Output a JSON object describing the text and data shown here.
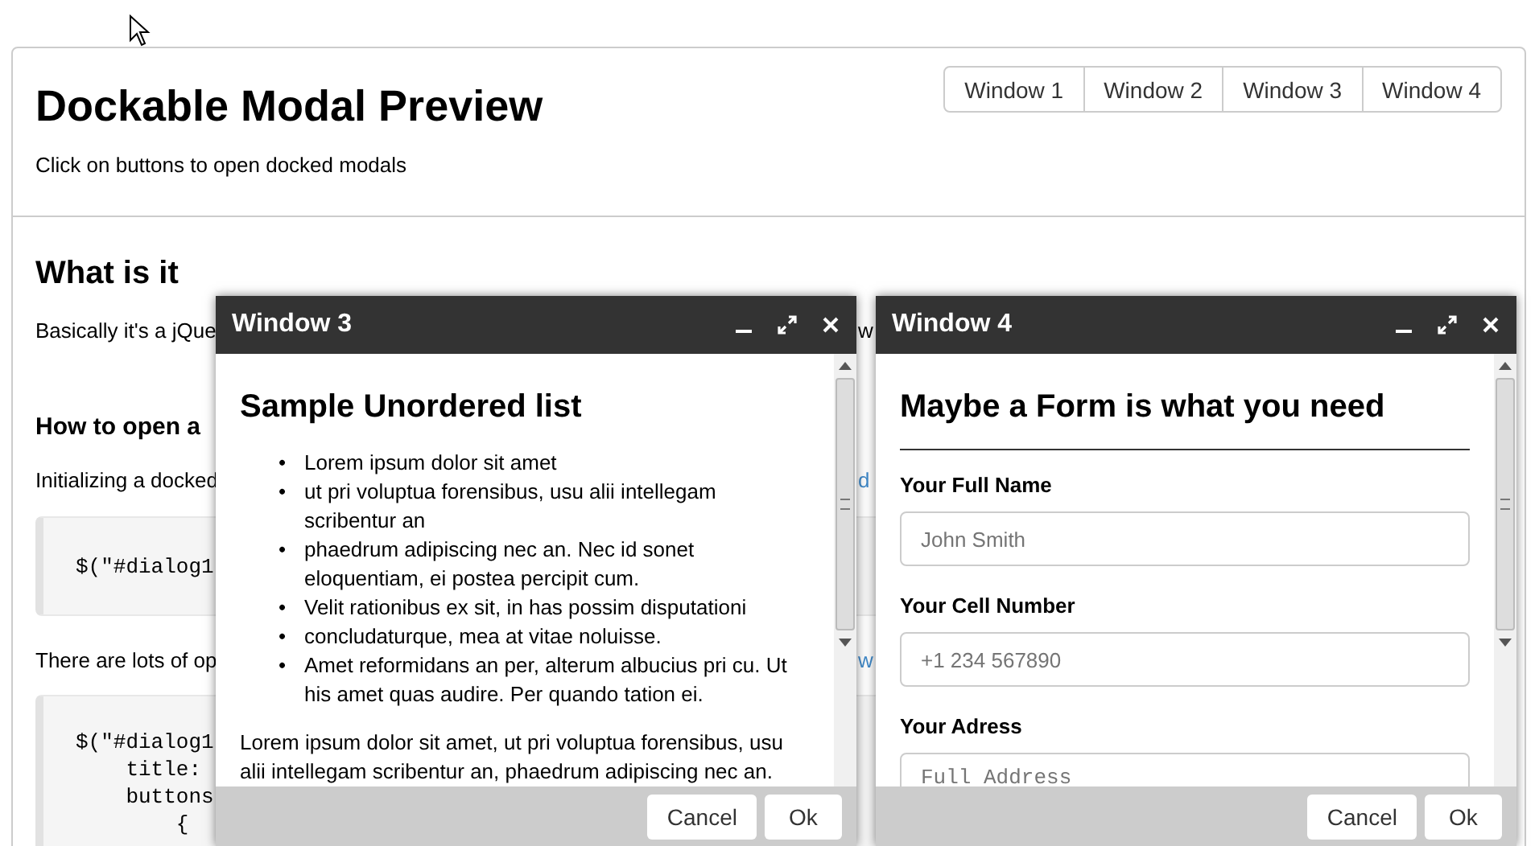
{
  "header": {
    "title": "Dockable Modal Preview",
    "subtitle": "Click on buttons to open docked modals",
    "window_buttons": [
      "Window 1",
      "Window 2",
      "Window 3",
      "Window 4"
    ]
  },
  "section": {
    "heading": "What is it",
    "intro": "Basically it's a jQue",
    "intro_tail": "w",
    "subheading": "How to open a",
    "init_text": "Initializing a docked",
    "init_tail": "d",
    "code_1": [
      "$(\"#dialog1"
    ],
    "options_text": "There are lots of op",
    "options_tail": "w",
    "code_2": [
      "$(\"#dialog1",
      "    title:",
      "    buttons",
      "        {"
    ]
  },
  "modals": [
    {
      "title": "Window 3",
      "kind": "list",
      "heading": "Sample Unordered list",
      "bullet": "•",
      "items": [
        "Lorem ipsum dolor sit amet",
        "ut pri voluptua forensibus, usu alii intellegam scribentur an",
        "phaedrum adipiscing nec an. Nec id sonet eloquentiam, ei postea percipit cum.",
        "Velit rationibus ex sit, in has possim disputationi",
        "concludaturque, mea at vitae noluisse.",
        "Amet reformidans an per, alterum albucius pri cu. Ut his amet quas audire. Per quando tation ei."
      ],
      "paragraph": "Lorem ipsum dolor sit amet, ut pri voluptua forensibus, usu alii intellegam scribentur an, phaedrum adipiscing nec an.",
      "buttons": [
        "Cancel",
        "Ok"
      ]
    },
    {
      "title": "Window 4",
      "kind": "form",
      "heading": "Maybe a Form is what you need",
      "fields": [
        {
          "label": "Your Full Name",
          "placeholder": "John Smith",
          "kind": "text"
        },
        {
          "label": "Your Cell Number",
          "placeholder": "+1 234 567890",
          "kind": "text"
        },
        {
          "label": "Your Adress",
          "placeholder": "Full Address",
          "kind": "textarea"
        }
      ],
      "buttons": [
        "Cancel",
        "Ok"
      ]
    }
  ]
}
